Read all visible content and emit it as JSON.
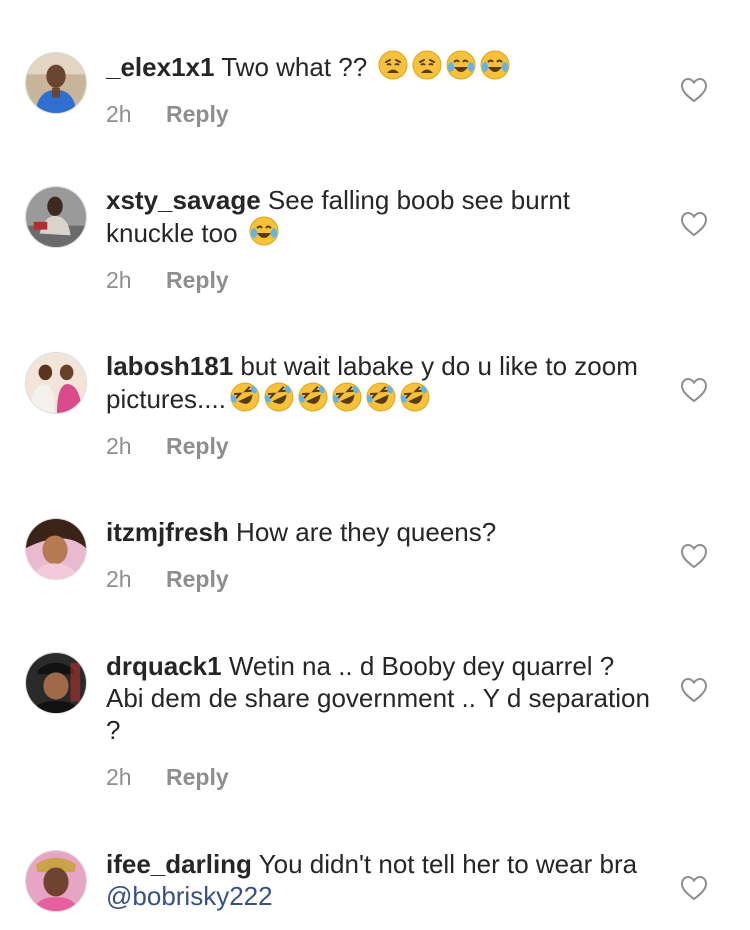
{
  "comments": [
    {
      "username": "_elex1x1",
      "text": "Two what ??",
      "emojis": [
        "weary",
        "weary",
        "joy",
        "joy"
      ],
      "trailing": "",
      "time": "2h",
      "reply": "Reply"
    },
    {
      "username": "xsty_savage",
      "text": "See falling boob see burnt knuckle too",
      "emojis": [
        "joy"
      ],
      "trailing": "",
      "time": "2h",
      "reply": "Reply"
    },
    {
      "username": "labosh181",
      "text": "but wait labake y do u like to zoom pictures....",
      "emojis": [
        "rofl",
        "rofl",
        "rofl",
        "rofl",
        "rofl",
        "rofl"
      ],
      "trailing": "",
      "time": "2h",
      "reply": "Reply"
    },
    {
      "username": "itzmjfresh",
      "text": "How are they queens?",
      "emojis": [],
      "trailing": "",
      "time": "2h",
      "reply": "Reply"
    },
    {
      "username": "drquack1",
      "text": "Wetin na .. d Booby dey quarrel ? Abi dem de share government .. Y d separation ?",
      "emojis": [],
      "trailing": "",
      "time": "2h",
      "reply": "Reply"
    },
    {
      "username": "ifee_darling",
      "text": "You didn't not tell her to wear bra",
      "emojis": [],
      "mention": "@bobrisky222",
      "time": "",
      "reply": ""
    }
  ],
  "icons": {
    "like": "heart-outline-icon",
    "emoji_weary": "weary-face-icon",
    "emoji_joy": "tears-of-joy-icon",
    "emoji_rofl": "rolling-on-floor-laughing-icon"
  },
  "colors": {
    "username": "#262626",
    "text": "#262626",
    "meta": "#8e8e8e",
    "mention": "#385185",
    "heart_stroke": "#8e8e8e"
  }
}
